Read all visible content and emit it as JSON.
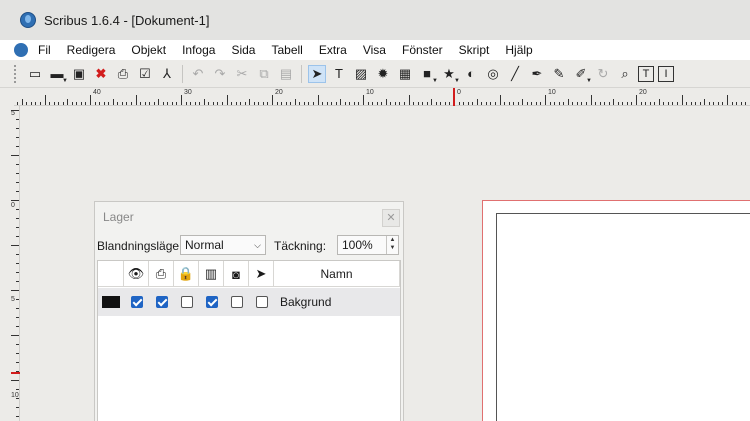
{
  "window": {
    "title": "Scribus 1.6.4 - [Dokument-1]"
  },
  "menu": [
    "Fil",
    "Redigera",
    "Objekt",
    "Infoga",
    "Sida",
    "Tabell",
    "Extra",
    "Visa",
    "Fönster",
    "Skript",
    "Hjälp"
  ],
  "toolbar": {
    "groups": [
      [
        {
          "name": "new-document-icon",
          "glyph": "▭"
        },
        {
          "name": "open-folder-icon",
          "glyph": "▬",
          "dropdown": true
        },
        {
          "name": "save-icon",
          "glyph": "▣"
        },
        {
          "name": "close-document-icon",
          "glyph": "✖",
          "style": "red"
        },
        {
          "name": "print-icon",
          "glyph": "⎙"
        },
        {
          "name": "preflight-check-icon",
          "glyph": "☑"
        },
        {
          "name": "export-pdf-icon",
          "glyph": "⅄"
        }
      ],
      [
        {
          "name": "undo-icon",
          "glyph": "↶",
          "style": "faded"
        },
        {
          "name": "redo-icon",
          "glyph": "↷",
          "style": "faded"
        },
        {
          "name": "cut-icon",
          "glyph": "✂",
          "style": "faded"
        },
        {
          "name": "copy-icon",
          "glyph": "⧉",
          "style": "faded"
        },
        {
          "name": "paste-icon",
          "glyph": "▤",
          "style": "faded"
        }
      ],
      [
        {
          "name": "select-pointer-icon",
          "glyph": "➤",
          "style": "active"
        },
        {
          "name": "text-frame-icon",
          "glyph": "T"
        },
        {
          "name": "image-frame-icon",
          "glyph": "▨"
        },
        {
          "name": "render-frame-icon",
          "glyph": "✹"
        },
        {
          "name": "table-icon",
          "glyph": "▦"
        },
        {
          "name": "shape-icon",
          "glyph": "■",
          "dropdown": true
        },
        {
          "name": "polygon-star-icon",
          "glyph": "★",
          "dropdown": true
        },
        {
          "name": "arc-icon",
          "glyph": "◐"
        },
        {
          "name": "spiral-icon",
          "glyph": "◎"
        },
        {
          "name": "line-icon",
          "glyph": "╱"
        },
        {
          "name": "bezier-pen-icon",
          "glyph": "✒"
        },
        {
          "name": "freehand-pencil-icon",
          "glyph": "✎"
        },
        {
          "name": "calligraphic-pen-icon",
          "glyph": "✐",
          "dropdown": true
        },
        {
          "name": "rotate-icon",
          "glyph": "↻",
          "style": "faded"
        },
        {
          "name": "zoom-icon",
          "glyph": "⌕"
        },
        {
          "name": "edit-text-icon",
          "glyph": "T",
          "style": "boxed"
        },
        {
          "name": "story-editor-icon",
          "glyph": "I",
          "style": "boxed"
        }
      ]
    ]
  },
  "ruler": {
    "labels": [
      "40",
      "30",
      "20",
      "10",
      "0",
      "10",
      "20"
    ],
    "vertical_labels": [
      "5",
      "0",
      "5",
      "10"
    ]
  },
  "layers_panel": {
    "title": "Lager",
    "close_glyph": "✕",
    "blend_label": "Blandningsläge:",
    "blend_value": "Normal",
    "opacity_label": "Täckning:",
    "opacity_value": "100%",
    "columns": {
      "name_header": "Namn",
      "icons": [
        "visible-eye-icon",
        "printable-icon",
        "lock-icon",
        "text-flow-icon",
        "outline-mode-icon",
        "selectable-pointer-icon"
      ],
      "icon_glyphs": [
        "👁",
        "⎙",
        "🔒",
        "▥",
        "◙",
        "➤"
      ]
    },
    "layers": [
      {
        "color": "#111111",
        "name": "Bakgrund",
        "visible": true,
        "printable": true,
        "locked": false,
        "flow": true,
        "outline": false,
        "selectable": false
      }
    ]
  }
}
